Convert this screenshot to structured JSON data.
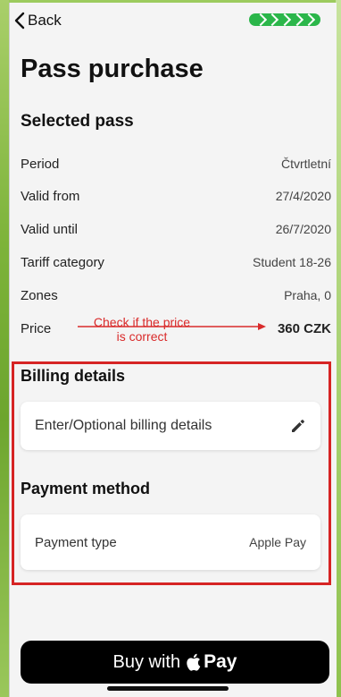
{
  "header": {
    "back_label": "Back",
    "progress_color": "#2bb64a"
  },
  "page": {
    "title": "Pass purchase"
  },
  "selected_pass": {
    "heading": "Selected pass",
    "rows": [
      {
        "label": "Period",
        "value": "Čtvrtletní"
      },
      {
        "label": "Valid from",
        "value": "27/4/2020"
      },
      {
        "label": "Valid until",
        "value": "26/7/2020"
      },
      {
        "label": "Tariff category",
        "value": "Student 18-26"
      },
      {
        "label": "Zones",
        "value": "Praha, 0"
      },
      {
        "label": "Price",
        "value": "360 CZK"
      }
    ]
  },
  "annotation": {
    "text_line1": "Check if the price",
    "text_line2": "is correct",
    "color": "#d92b2b"
  },
  "billing": {
    "heading": "Billing details",
    "placeholder": "Enter/Optional billing details",
    "icon": "pencil-icon"
  },
  "payment": {
    "heading": "Payment method",
    "label": "Payment type",
    "value": "Apple Pay"
  },
  "buy_button": {
    "label": "Buy with",
    "pay_text": "Pay",
    "icon": "apple-logo-icon"
  }
}
